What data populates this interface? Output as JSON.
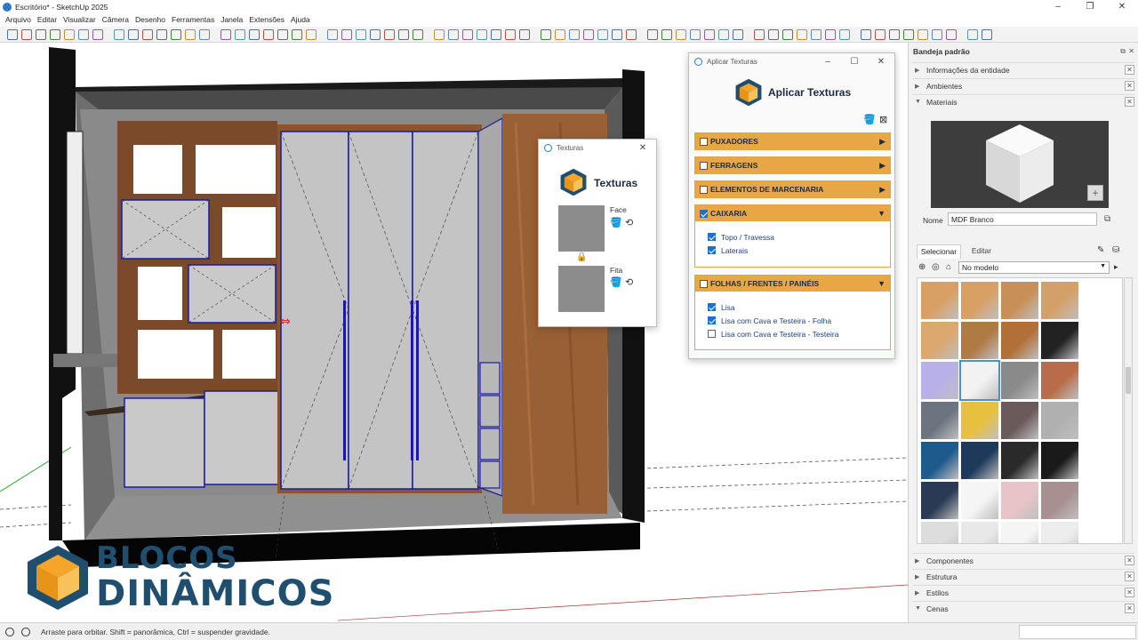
{
  "window": {
    "title": "Escritório* - SketchUp 2025"
  },
  "menu": [
    "Arquivo",
    "Editar",
    "Visualizar",
    "Câmera",
    "Desenho",
    "Ferramentas",
    "Janela",
    "Extensões",
    "Ajuda"
  ],
  "aplicar_dialog": {
    "window_title": "Aplicar Texturas",
    "header_title": "Aplicar Texturas",
    "sections": [
      {
        "label": "PUXADORES",
        "checked": false,
        "expanded": false,
        "options": []
      },
      {
        "label": "FERRAGENS",
        "checked": false,
        "expanded": false,
        "options": []
      },
      {
        "label": "ELEMENTOS DE MARCENARIA",
        "checked": false,
        "expanded": false,
        "options": []
      },
      {
        "label": "CAIXARIA",
        "checked": true,
        "expanded": true,
        "options": [
          {
            "label": "Topo / Travessa",
            "checked": true
          },
          {
            "label": "Laterais",
            "checked": true
          }
        ]
      },
      {
        "label": "FOLHAS / FRENTES / PAINÉIS",
        "checked": false,
        "expanded": true,
        "options": [
          {
            "label": "Lisa",
            "checked": true
          },
          {
            "label": "Lisa com Cava e Testeira - Folha",
            "checked": true
          },
          {
            "label": "Lisa com Cava e Testeira - Testeira",
            "checked": false
          }
        ]
      }
    ]
  },
  "texturas_dialog": {
    "window_title": "Texturas",
    "header_title": "Texturas",
    "face_label": "Face",
    "fita_label": "Fita"
  },
  "tray": {
    "title": "Bandeja padrão",
    "panels_top": [
      "Informações da entidade",
      "Ambientes",
      "Materiais"
    ],
    "material_name_label": "Nome",
    "material_name_value": "MDF Branco",
    "tabs": [
      "Selecionar",
      "Editar"
    ],
    "dropdown_value": "No modelo",
    "panels_bottom": [
      "Componentes",
      "Estrutura",
      "Estilos",
      "Cenas"
    ]
  },
  "status": {
    "text": "Arraste para orbitar. Shift = panorâmica, Ctrl = suspender gravidade."
  },
  "logo": {
    "line1": "BLOCOS",
    "line2": "DINÂMICOS"
  },
  "colors": {
    "accent_orange": "#e8a744",
    "navy": "#1b2b45",
    "teal_logo": "#1f4e6e",
    "edge_blue": "#1a1aa8"
  }
}
